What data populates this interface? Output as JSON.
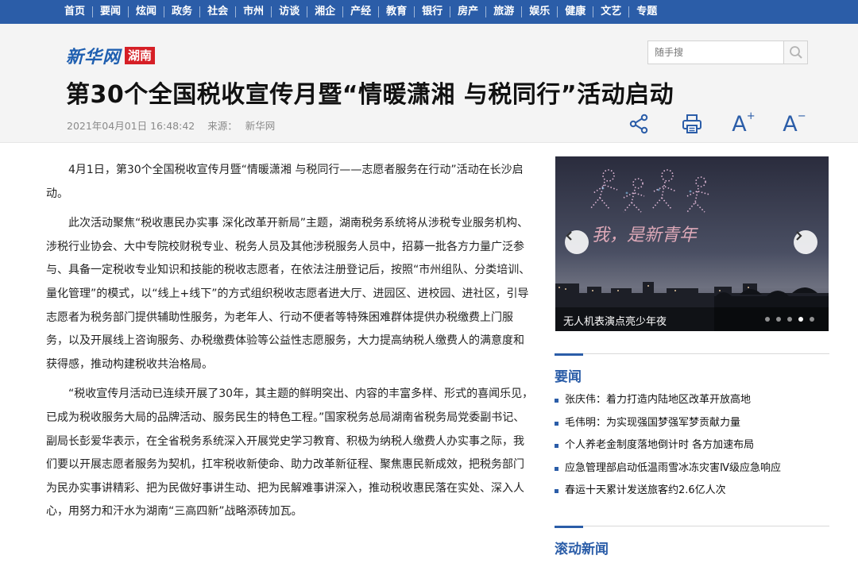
{
  "nav": {
    "items": [
      "首页",
      "要闻",
      "炫闻",
      "政务",
      "社会",
      "市州",
      "访谈",
      "湘企",
      "产经",
      "教育",
      "银行",
      "房产",
      "旅游",
      "娱乐",
      "健康",
      "文艺",
      "专题"
    ]
  },
  "header": {
    "logo_brand": "新华网",
    "logo_region": "湖南",
    "search_placeholder": "随手搜"
  },
  "article": {
    "title": "第30个全国税收宣传月暨“情暖潇湘 与税同行”活动启动",
    "datetime": "2021年04月01日 16:48:42",
    "source_label": "来源：",
    "source": "新华网",
    "paragraphs": [
      "4月1日，第30个全国税收宣传月暨“情暖潇湘 与税同行——志愿者服务在行动”活动在长沙启动。",
      "此次活动聚焦“税收惠民办实事 深化改革开新局”主题，湖南税务系统将从涉税专业服务机构、涉税行业协会、大中专院校财税专业、税务人员及其他涉税服务人员中，招募一批各方力量广泛参与、具备一定税收专业知识和技能的税收志愿者，在依法注册登记后，按照“市州组队、分类培训、量化管理”的模式，以“线上+线下”的方式组织税收志愿者进大厅、进园区、进校园、进社区，引导志愿者为税务部门提供辅助性服务，为老年人、行动不便者等特殊困难群体提供办税缴费上门服务，以及开展线上咨询服务、办税缴费体验等公益性志愿服务，大力提高纳税人缴费人的满意度和获得感，推动构建税收共治格局。",
      "“税收宣传月活动已连续开展了30年，其主题的鲜明突出、内容的丰富多样、形式的喜闻乐见，已成为税收服务大局的品牌活动、服务民生的特色工程。”国家税务总局湖南省税务局党委副书记、副局长彭爱华表示，在全省税务系统深入开展党史学习教育、积极为纳税人缴费人办实事之际，我们要以开展志愿者服务为契机，扛牢税收新使命、助力改革新征程、聚焦惠民新成效，把税务部门为民办实事讲精彩、把为民做好事讲生动、把为民解难事讲深入，推动税收惠民落在实处、深入人心，用努力和汗水为湖南“三高四新”战略添砖加瓦。"
    ]
  },
  "slideshow": {
    "caption": "无人机表演点亮少年夜",
    "image_text": "我，是新青年",
    "dot_count": 5,
    "active_dot": 3
  },
  "sidebar": {
    "yaowen_title": "要闻",
    "news": [
      "张庆伟：着力打造内陆地区改革开放高地",
      "毛伟明：为实现强国梦强军梦贡献力量",
      "个人养老金制度落地倒计时 各方加速布局",
      "应急管理部启动低温雨雪冰冻灾害Ⅳ级应急响应",
      "春运十天累计发送旅客约2.6亿人次"
    ],
    "gundong_title": "滚动新闻"
  },
  "colors": {
    "brand_blue": "#2b5da8",
    "logo_red": "#d61f26"
  },
  "icons": [
    "search-icon",
    "share-icon",
    "print-icon",
    "font-increase-icon",
    "font-decrease-icon",
    "chevron-left-icon",
    "chevron-right-icon"
  ]
}
